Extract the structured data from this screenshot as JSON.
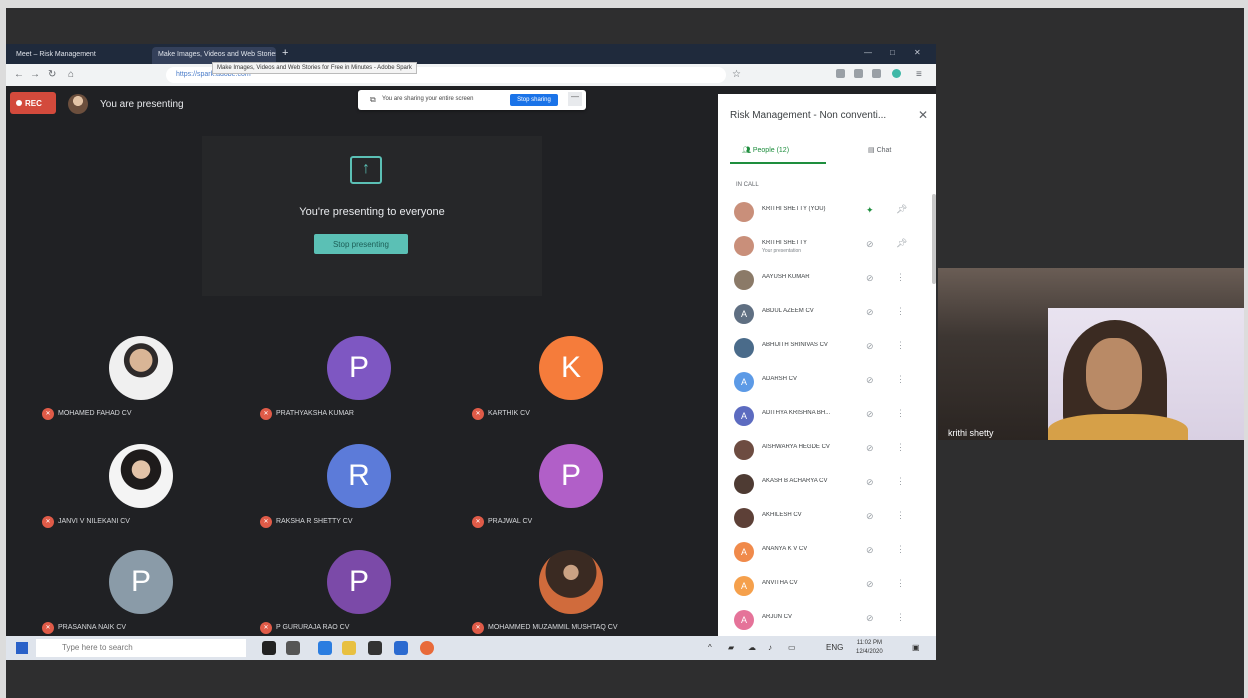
{
  "browser": {
    "tabs": [
      {
        "label": "Meet – Risk Management"
      },
      {
        "label": "Make Images, Videos and Web Stories"
      }
    ],
    "tooltip": "Make Images, Videos and Web Stories for Free in Minutes - Adobe Spark",
    "url": "https://spark.adobe.com"
  },
  "meet": {
    "rec_label": "REC",
    "presenting_label": "You are presenting",
    "sharebar": {
      "text": "You are sharing your entire screen",
      "stop_label": "Stop sharing",
      "hide_label": "—"
    },
    "present_title": "You're presenting to everyone",
    "stop_presenting_label": "Stop presenting",
    "tiles": [
      {
        "name": "MOHAMED FAHAD CV",
        "letter": "",
        "color": "#ffffff",
        "photo": "photo"
      },
      {
        "name": "Prathyaksha Kumar",
        "letter": "P",
        "color": "#7e57c2",
        "photo": ""
      },
      {
        "name": "KARTHIK CV",
        "letter": "K",
        "color": "#f57c3b",
        "photo": ""
      },
      {
        "name": "JANVI V NILEKANI CV",
        "letter": "",
        "color": "#ffffff",
        "photo": "photo2"
      },
      {
        "name": "RAKSHA R SHETTY CV",
        "letter": "R",
        "color": "#5c7bd9",
        "photo": ""
      },
      {
        "name": "PRAJWAL CV",
        "letter": "P",
        "color": "#b15fc8",
        "photo": ""
      },
      {
        "name": "PRASANNA NAIK CV",
        "letter": "P",
        "color": "#8a9ba8",
        "photo": ""
      },
      {
        "name": "P GURURAJA RAO CV",
        "letter": "P",
        "color": "#7b4aa8",
        "photo": ""
      },
      {
        "name": "MOHAMMED MUZAMMIL MUSHTAQ CV",
        "letter": "",
        "color": "#ffffff",
        "photo": "photo3"
      }
    ]
  },
  "panel": {
    "title": "Risk Management - Non conventi...",
    "people_tab": "People (12)",
    "chat_tab": "Chat",
    "section": "IN CALL",
    "participants": [
      {
        "name": "krithi shetty (You)",
        "sub": "",
        "initial": "",
        "color": "#c98f7a",
        "mic": "✦"
      },
      {
        "name": "krithi shetty",
        "sub": "Your presentation",
        "initial": "",
        "color": "#c98f7a",
        "mic": "⊘"
      },
      {
        "name": "Aayush Kumar",
        "sub": "",
        "initial": "",
        "color": "#8b7a68",
        "mic": "⊘"
      },
      {
        "name": "ABDUL AZEEM CV",
        "sub": "",
        "initial": "A",
        "color": "#5f6f82",
        "mic": "⊘"
      },
      {
        "name": "ABHIJITH SRINIVAS CV",
        "sub": "",
        "initial": "",
        "color": "#4a6b8a",
        "mic": "⊘"
      },
      {
        "name": "ADARSH CV",
        "sub": "",
        "initial": "A",
        "color": "#5c9ae6",
        "mic": "⊘"
      },
      {
        "name": "ADITHYA KRISHNA BH...",
        "sub": "",
        "initial": "A",
        "color": "#5c6bc0",
        "mic": "⊘"
      },
      {
        "name": "AISHWARYA HEGDE CV",
        "sub": "",
        "initial": "",
        "color": "#6d4c41",
        "mic": "⊘"
      },
      {
        "name": "AKASH B ACHARYA CV",
        "sub": "",
        "initial": "",
        "color": "#4e3b33",
        "mic": "⊘"
      },
      {
        "name": "AKHILESH CV",
        "sub": "",
        "initial": "",
        "color": "#5d4037",
        "mic": "⊘"
      },
      {
        "name": "ANANYA K V CV",
        "sub": "",
        "initial": "A",
        "color": "#f08a4b",
        "mic": "⊘"
      },
      {
        "name": "ANVITHA CV",
        "sub": "",
        "initial": "A",
        "color": "#f5a04c",
        "mic": "⊘"
      },
      {
        "name": "ARJUN CV",
        "sub": "",
        "initial": "A",
        "color": "#e57399",
        "mic": "⊘"
      }
    ]
  },
  "taskbar": {
    "search_placeholder": "Type here to search",
    "lang": "ENG",
    "time": "11:02 PM",
    "date": "12/4/2020"
  },
  "webcam": {
    "name": "krithi shetty"
  }
}
